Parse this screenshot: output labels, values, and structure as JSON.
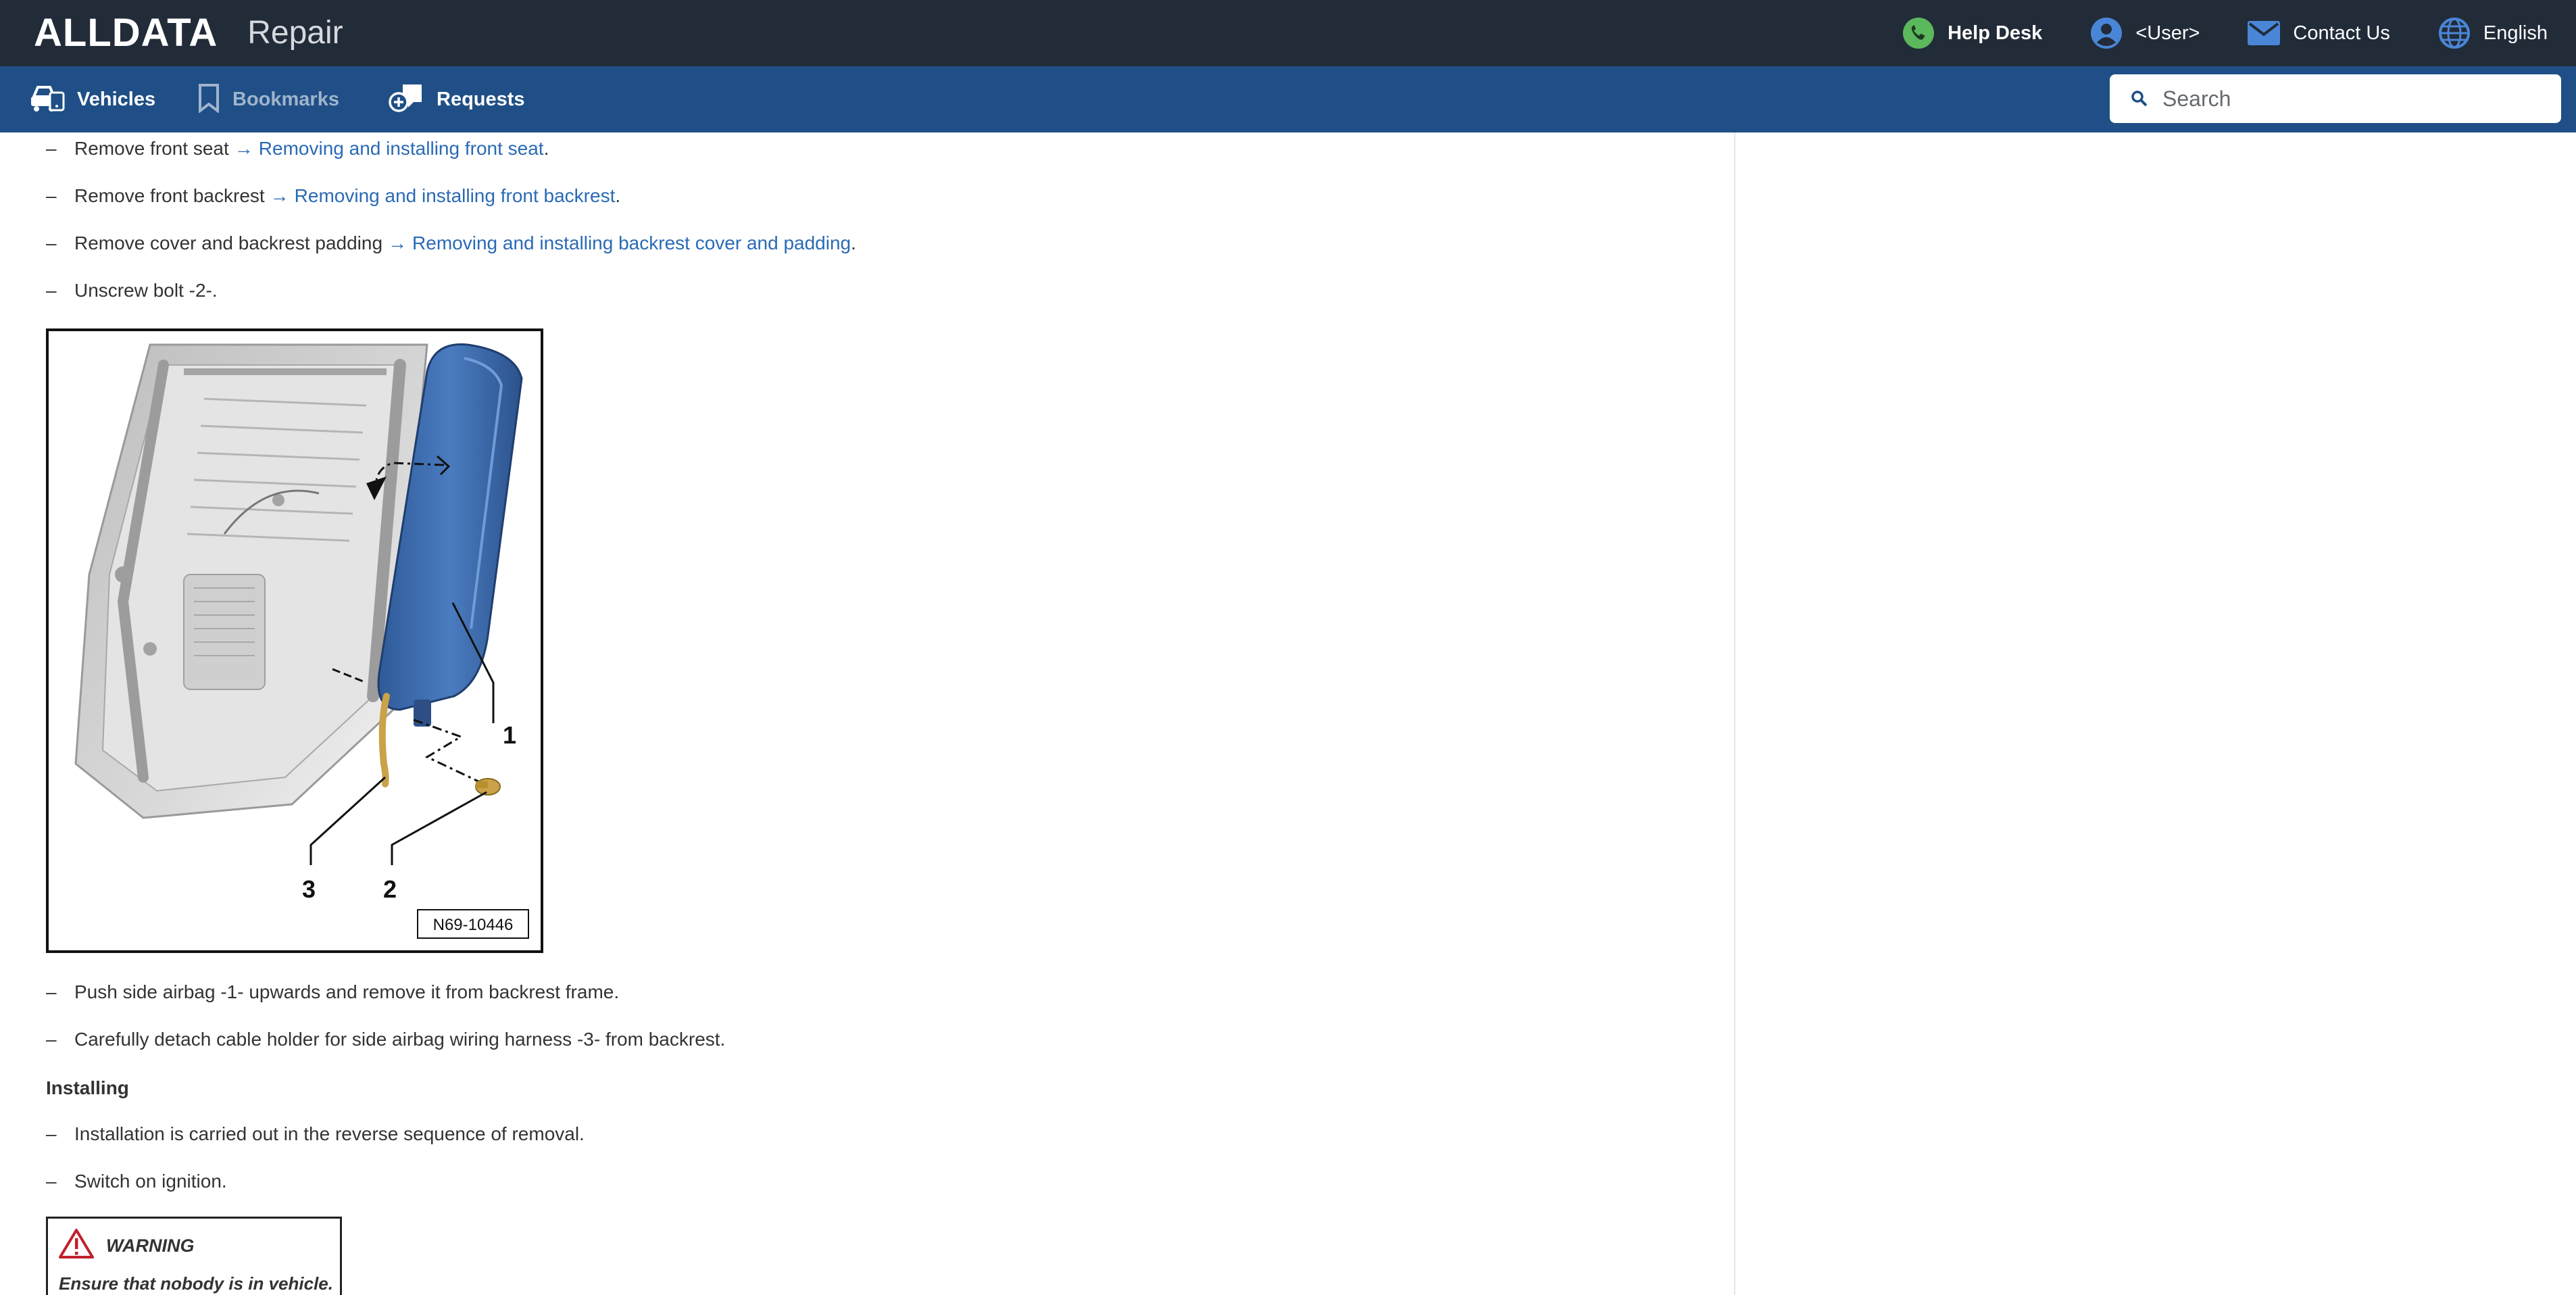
{
  "header": {
    "logo": "ALLDATA",
    "app_name": "Repair",
    "links": {
      "help_desk": "Help Desk",
      "user": "<User>",
      "contact_us": "Contact Us",
      "language": "English"
    }
  },
  "nav": {
    "vehicles": "Vehicles",
    "bookmarks": "Bookmarks",
    "requests": "Requests"
  },
  "search": {
    "placeholder": "Search"
  },
  "procedure": {
    "steps_before": [
      {
        "text": "Remove front seat",
        "link": "Removing and installing front seat",
        "tail": "."
      },
      {
        "text": "Remove front backrest",
        "link": "Removing and installing front backrest",
        "tail": "."
      },
      {
        "text": "Remove cover and backrest padding",
        "link": "Removing and installing backrest cover and padding",
        "tail": "."
      },
      {
        "text": "Unscrew bolt -2-."
      }
    ],
    "arrow": "→",
    "figure": {
      "code": "N69-10446",
      "callouts": [
        "1",
        "2",
        "3"
      ]
    },
    "steps_after": [
      {
        "text": "Push side airbag -1- upwards and remove it from backrest frame."
      },
      {
        "text": "Carefully detach cable holder for side airbag wiring harness -3- from backrest."
      }
    ],
    "installing_heading": "Installing",
    "install_steps": [
      {
        "text": "Installation is carried out in the reverse sequence of removal."
      },
      {
        "text": "Switch on ignition."
      }
    ],
    "warning": {
      "label": "WARNING",
      "message": "Ensure that nobody is in vehicle."
    }
  },
  "colors": {
    "header_bg": "#222b38",
    "nav_bg": "#1f4f86",
    "link": "#2a6ab5",
    "help_icon": "#5cb85c",
    "airbag_blue": "#3e6eb0",
    "warning_red": "#c0202b"
  }
}
